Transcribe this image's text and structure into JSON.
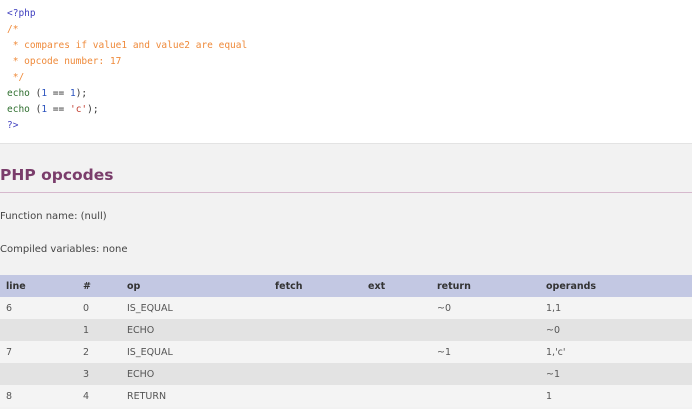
{
  "code": {
    "lines": [
      [
        {
          "t": "<?php",
          "c": "tag"
        }
      ],
      [
        {
          "t": "/*",
          "c": "comment"
        }
      ],
      [
        {
          "t": " * compares if value1 and value2 are equal",
          "c": "comment"
        }
      ],
      [
        {
          "t": " * opcode number: 17",
          "c": "comment"
        }
      ],
      [
        {
          "t": " */",
          "c": "comment"
        }
      ],
      [
        {
          "t": "echo",
          "c": "fn"
        },
        {
          "t": " (",
          "c": "plain"
        },
        {
          "t": "1",
          "c": "num"
        },
        {
          "t": " == ",
          "c": "plain"
        },
        {
          "t": "1",
          "c": "num"
        },
        {
          "t": ");",
          "c": "plain"
        }
      ],
      [
        {
          "t": "echo",
          "c": "fn"
        },
        {
          "t": " (",
          "c": "plain"
        },
        {
          "t": "1",
          "c": "num"
        },
        {
          "t": " == ",
          "c": "plain"
        },
        {
          "t": "'c'",
          "c": "str"
        },
        {
          "t": ");",
          "c": "plain"
        }
      ],
      [
        {
          "t": "?>",
          "c": "tag"
        }
      ]
    ]
  },
  "opcodes_section": {
    "title": "PHP opcodes",
    "function_name": "Function name: (null)",
    "compiled_variables": "Compiled variables: none"
  },
  "table": {
    "headers": [
      "line",
      "#",
      "op",
      "fetch",
      "ext",
      "return",
      "operands"
    ],
    "rows": [
      [
        "6",
        "0",
        "IS_EQUAL",
        "",
        "",
        "~0",
        "1,1"
      ],
      [
        "",
        "1",
        "ECHO",
        "",
        "",
        "",
        "~0"
      ],
      [
        "7",
        "2",
        "IS_EQUAL",
        "",
        "",
        "~1",
        "1,'c'"
      ],
      [
        "",
        "3",
        "ECHO",
        "",
        "",
        "",
        "~1"
      ],
      [
        "8",
        "4",
        "RETURN",
        "",
        "",
        "",
        "1"
      ]
    ]
  }
}
